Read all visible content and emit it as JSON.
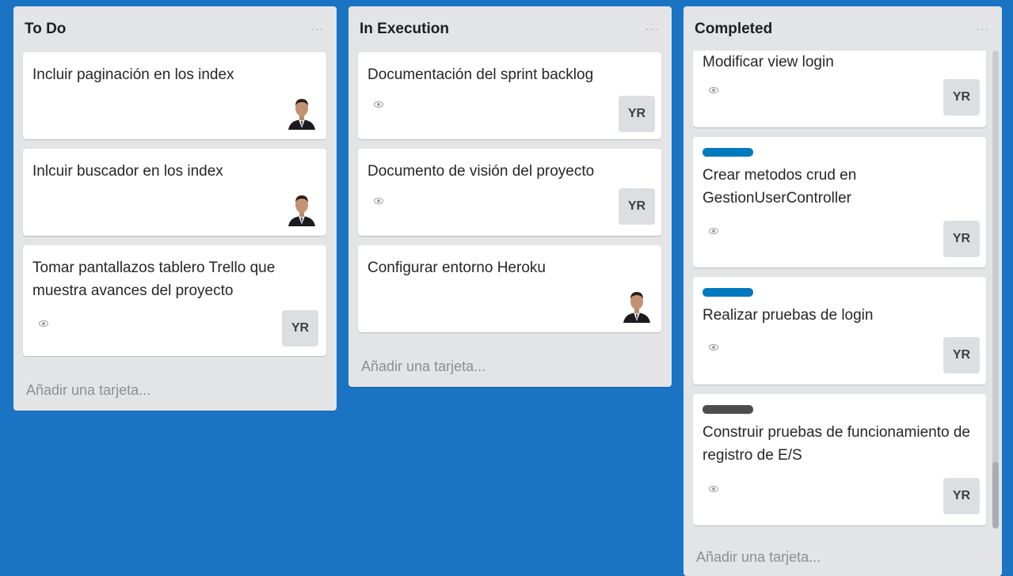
{
  "board": {
    "background": "#1a73c3"
  },
  "lists": [
    {
      "title": "To Do",
      "menu": "···",
      "add_card": "Añadir una tarjeta...",
      "cards": [
        {
          "title": "Incluir paginación en los index"
        },
        {
          "title": "Inlcuir buscador en los index"
        },
        {
          "title": "Tomar pantallazos tablero Trello que muestra avances del proyecto",
          "member": "YR"
        }
      ]
    },
    {
      "title": "In Execution",
      "menu": "···",
      "add_card": "Añadir una tarjeta...",
      "cards": [
        {
          "title": "Documentación del sprint backlog",
          "member": "YR"
        },
        {
          "title": "Documento de visión del proyecto",
          "member": "YR"
        },
        {
          "title": "Configurar entorno Heroku"
        }
      ]
    },
    {
      "title": "Completed",
      "menu": "···",
      "add_card": "Añadir una tarjeta...",
      "cards": [
        {
          "title": "Modificar view login",
          "member": "YR"
        },
        {
          "title": "Crear metodos crud en GestionUserController",
          "member": "YR",
          "label_color": "#0079bf"
        },
        {
          "title": "Realizar pruebas de login",
          "member": "YR",
          "label_color": "#0079bf"
        },
        {
          "title": "Construir pruebas de funcionamiento de registro de E/S",
          "member": "YR",
          "label_color": "#4d4d4d"
        }
      ]
    }
  ],
  "icons": {
    "watch": "eye-icon",
    "avatar": "user-photo-avatar",
    "menu": "more-options-icon"
  }
}
